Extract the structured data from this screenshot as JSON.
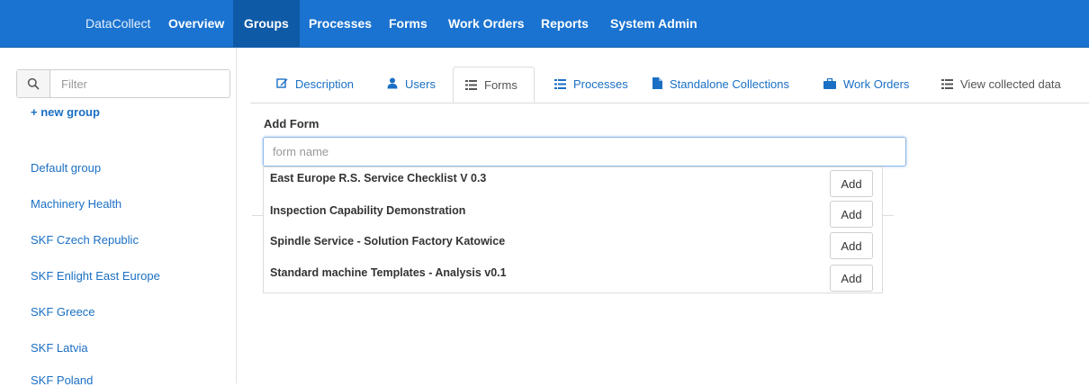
{
  "navbar": {
    "brand": "DataCollect",
    "items": [
      "Overview",
      "Groups",
      "Processes",
      "Forms",
      "Work Orders",
      "Reports",
      "System Admin"
    ],
    "active": "Groups",
    "bg_color": "#1a73d0"
  },
  "sidebar": {
    "filter_placeholder": "Filter",
    "new_group_label": "+ new group",
    "groups": [
      "Default group",
      "Machinery Health",
      "SKF Czech Republic",
      "SKF Enlight East Europe",
      "SKF Greece",
      "SKF Latvia",
      "SKF Poland"
    ]
  },
  "tabs": [
    {
      "label": "Description",
      "icon": "edit-icon"
    },
    {
      "label": "Users",
      "icon": "user-icon"
    },
    {
      "label": "Forms",
      "icon": "list-icon",
      "active": true
    },
    {
      "label": "Processes",
      "icon": "list-icon"
    },
    {
      "label": "Standalone Collections",
      "icon": "file-icon"
    },
    {
      "label": "Work Orders",
      "icon": "briefcase-icon"
    },
    {
      "label": "View collected data",
      "icon": "th-list-icon"
    }
  ],
  "add_form": {
    "label": "Add Form",
    "placeholder": "form name",
    "suggestions": [
      {
        "name": "East Europe R.S. Service Checklist V 0.3",
        "button": "Add"
      },
      {
        "name": "Inspection Capability Demonstration",
        "button": "Add"
      },
      {
        "name": "Spindle Service - Solution Factory Katowice",
        "button": "Add"
      },
      {
        "name": "Standard machine Templates - Analysis v0.1",
        "button": "Add"
      }
    ]
  },
  "colors": {
    "link": "#1a6fc4",
    "navbar": "#1a73d0",
    "navbar_active": "#0f5aa6"
  }
}
